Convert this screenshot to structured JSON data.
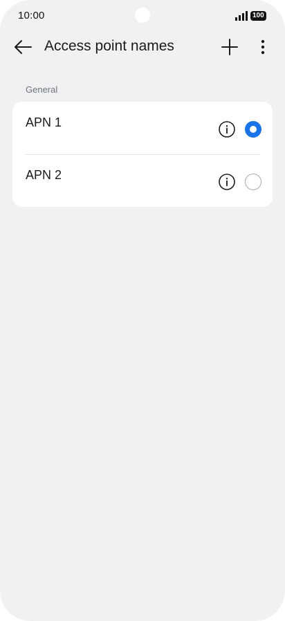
{
  "status_bar": {
    "time": "10:00",
    "battery": "100",
    "signal_icon": "signal-bars-icon",
    "battery_icon": "battery-icon"
  },
  "app_bar": {
    "title": "Access point names",
    "back_icon": "arrow-left-icon",
    "add_icon": "plus-icon",
    "more_icon": "more-vertical-icon"
  },
  "section": {
    "label": "General",
    "items": [
      {
        "name": "APN 1",
        "selected": true,
        "info_icon": "info-icon"
      },
      {
        "name": "APN 2",
        "selected": false,
        "info_icon": "info-icon"
      }
    ]
  },
  "colors": {
    "background": "#f0f1f3",
    "card": "#ffffff",
    "accent": "#1a73e8",
    "radio_unselected": "#a9abae",
    "text_primary": "#1a1a1a",
    "text_secondary": "#6f7276"
  }
}
